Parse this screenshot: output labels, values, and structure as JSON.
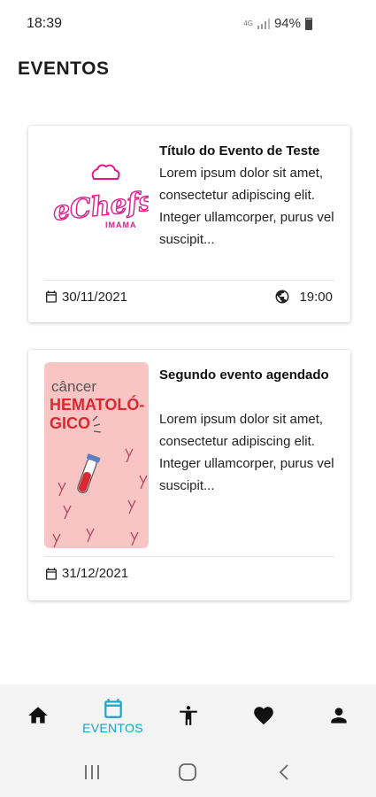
{
  "status_bar": {
    "time": "18:39",
    "network": "4G",
    "battery": "94%"
  },
  "page": {
    "title": "EVENTOS"
  },
  "events": [
    {
      "title": "Título do Evento de Teste",
      "description": "Lorem ipsum dolor sit amet, consectetur adipiscing elit. Integer ullamcorper, purus vel suscipit...",
      "date": "30/11/2021",
      "time": "19:00",
      "image_logo_text": "eChefs",
      "image_logo_subtext": "IMAMA"
    },
    {
      "title": "Segundo evento agendado",
      "description": "Lorem ipsum dolor sit amet, consectetur adipiscing elit. Integer ullamcorper, purus vel suscipit...",
      "date": "31/12/2021",
      "image_line1": "câncer",
      "image_line2": "HEMATOLÓ-",
      "image_line3": "GICO"
    }
  ],
  "bottom_nav": {
    "items": [
      {
        "icon": "home-icon",
        "label": ""
      },
      {
        "icon": "calendar-icon",
        "label": "EVENTOS"
      },
      {
        "icon": "accessibility-icon",
        "label": ""
      },
      {
        "icon": "heart-icon",
        "label": ""
      },
      {
        "icon": "person-icon",
        "label": ""
      }
    ],
    "active_index": 1
  },
  "colors": {
    "accent": "#1aa3c6",
    "logo_pink": "#e0198a",
    "card_image_bg": "#f9c4c4",
    "cancer_red": "#d9282f"
  }
}
